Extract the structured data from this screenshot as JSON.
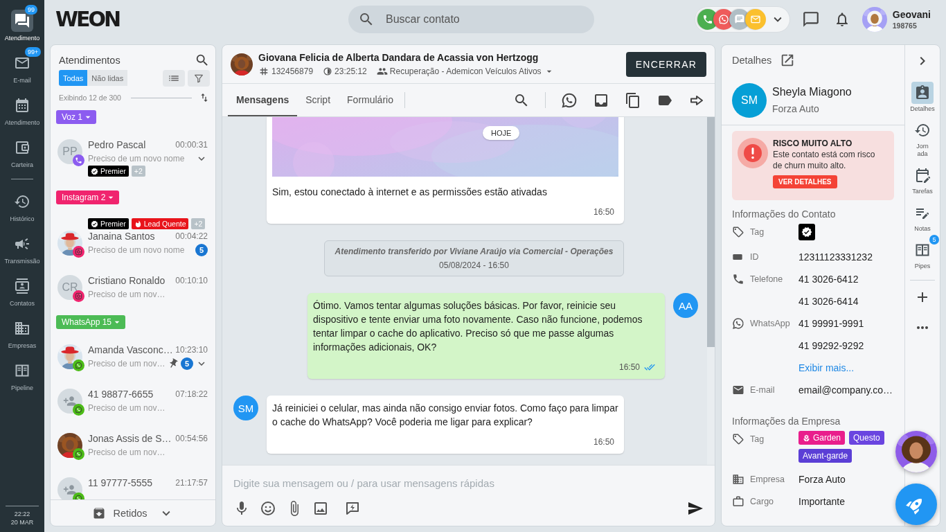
{
  "rail": {
    "sections": [
      {
        "items": [
          {
            "kind": "chat",
            "label": "Atendimento",
            "badge": "99",
            "selected": true
          },
          {
            "kind": "mail",
            "label": "E-mail",
            "badge": "99+",
            "selected": false
          },
          {
            "kind": "calendar",
            "label": "Atendimento",
            "selected": false
          },
          {
            "kind": "wallet",
            "label": "Carteira",
            "selected": false
          }
        ]
      },
      {
        "items": [
          {
            "kind": "history",
            "label": "Histórico",
            "selected": false
          },
          {
            "kind": "megaphone",
            "label": "Transmissão",
            "selected": false
          },
          {
            "kind": "contacts",
            "label": "Contatos",
            "selected": false
          },
          {
            "kind": "building",
            "label": "Empresas",
            "selected": false
          },
          {
            "kind": "pipeline",
            "label": "Pipeline",
            "selected": false
          }
        ]
      }
    ],
    "clock": {
      "time": "22:22",
      "date": "20 MAR"
    }
  },
  "topbar": {
    "logo": "WEON",
    "search": {
      "placeholder": "Buscar contato"
    },
    "channels": [
      {
        "kind": "phone",
        "color": "#4caf50"
      },
      {
        "kind": "whatsapp",
        "color": "#ef5b5b"
      },
      {
        "kind": "sms",
        "color": "#b0bec5"
      },
      {
        "kind": "mail",
        "color": "#fbc02d"
      }
    ],
    "user": {
      "name": "Geovani",
      "id": "198765"
    }
  },
  "conversations": {
    "title": "Atendimentos",
    "filters": [
      {
        "label": "Todas",
        "selected": true
      },
      {
        "label": "Não lidas",
        "selected": false
      }
    ],
    "count": "Exibindo 12 de 300",
    "groups": [
      {
        "label": "Voz 1",
        "color": "#8c5cf0",
        "items": [
          {
            "name": "Pedro Pascal",
            "time": "00:00:31",
            "preview": "Preciso de um novo nome",
            "avatar": {
              "kind": "initials",
              "text": "PP"
            },
            "channel": {
              "kind": "phone"
            },
            "kind": "tagsbelow",
            "tags": [
              {
                "kind": "premier",
                "label": "Premier",
                "color": "#000000"
              },
              {
                "kind": "more",
                "label": "+2",
                "color": "#b8c2c8"
              }
            ],
            "pinned": false,
            "menu": true
          }
        ]
      },
      {
        "label": "Instagram 2",
        "color": "#f0246e",
        "items": [
          {
            "name": "Janaina Santos",
            "time": "00:04:22",
            "preview": "Preciso de um novo nome",
            "avatar": {
              "kind": "picture"
            },
            "channel": {
              "kind": "instagram"
            },
            "kind": "tagsabove",
            "tags": [
              {
                "kind": "premier",
                "label": "Premier",
                "color": "#000000"
              },
              {
                "kind": "hot",
                "label": "Lead Quente",
                "color": "#e8141b"
              },
              {
                "kind": "more",
                "label": "+2",
                "color": "#b8c2c8"
              }
            ],
            "unread": "5",
            "pinned": false,
            "menu": false
          },
          {
            "name": "Cristiano Ronaldo",
            "time": "00:10:10",
            "preview": "Preciso de um nov…",
            "avatar": {
              "kind": "initials",
              "text": "CR"
            },
            "channel": {
              "kind": "instagram"
            },
            "pinned": false,
            "menu": false
          }
        ]
      },
      {
        "label": "WhatsApp 15",
        "color": "#4cbb55",
        "items": [
          {
            "name": "Amanda Vasconc…",
            "time": "10:23:10",
            "preview": "Preciso de um nov…",
            "avatar": {
              "kind": "picture"
            },
            "channel": {
              "kind": "whatsapp"
            },
            "unread": "5",
            "pinned": true,
            "menu": true
          },
          {
            "name": "41 98877-6655",
            "time": "07:18:22",
            "preview": "Preciso de um nov…",
            "avatar": {
              "kind": "unknown"
            },
            "channel": {
              "kind": "whatsapp"
            },
            "pinned": false,
            "menu": false
          },
          {
            "name": "Jonas Assis de S…",
            "time": "00:54:56",
            "preview": "Preciso de um nov…",
            "avatar": {
              "kind": "picture"
            },
            "channel": {
              "kind": "whatsapp"
            },
            "pinned": false,
            "menu": false
          },
          {
            "name": "11 97777-5555",
            "time": "21:17:57",
            "avatar": {
              "kind": "unknown"
            },
            "channel": {
              "kind": "whatsapp"
            },
            "pinned": false,
            "menu": false
          }
        ]
      }
    ],
    "footer": "Retidos"
  },
  "chat": {
    "contact": {
      "name": "Giovana Felicia de Alberta Dandara de Acassia von Hertzogg",
      "protocol": "132456879",
      "timer": "23:25:12",
      "queue": "Recuperação - Ademicon Veículos Ativos"
    },
    "close_button": "ENCERRAR",
    "tabs": [
      {
        "label": "Mensagens",
        "selected": true
      },
      {
        "label": "Script",
        "selected": false
      },
      {
        "label": "Formulário",
        "selected": false
      }
    ],
    "date_chip": "HOJE",
    "messages": [
      {
        "kind": "incoming",
        "image": {
          "kind": "picture"
        },
        "text": "Sim, estou conectado à internet e as permissões estão ativadas",
        "time": "16:50"
      },
      {
        "kind": "system",
        "text": "Atendimento transferido por Viviane Araújo via Comercial - Operações",
        "date": "05/08/2024 - 16:50"
      },
      {
        "kind": "outgoing",
        "avatar": "AA",
        "text": "Ótimo. Vamos tentar algumas soluções básicas. Por favor, reinicie seu dispositivo e tente enviar uma foto novamente. Caso não funcione, podemos tentar limpar o cache do aplicativo. Preciso só que me passe algumas informações adicionais, OK?",
        "time": "16:50",
        "read": true
      },
      {
        "kind": "incoming",
        "avatar": "SM",
        "text": "Já reiniciei o celular, mas ainda não consigo enviar fotos. Como faço para limpar o cache do WhatsApp? Você poderia me ligar para explicar?",
        "time": "16:50"
      }
    ],
    "composer": {
      "placeholder": "Digite sua mensagem ou / para usar mensagens rápidas"
    }
  },
  "details": {
    "title": "Detalhes",
    "contact": {
      "initials": "SM",
      "name": "Sheyla Miagono",
      "company": "Forza Auto"
    },
    "alert": {
      "title": "RISCO MUITO ALTO",
      "text": "Este contato está com risco de churn muito alto.",
      "button": "VER DETALHES"
    },
    "contact_info": {
      "title": "Informações do Contato",
      "rows": [
        {
          "kind": "tag",
          "label": "Tag",
          "tags": [
            {
              "kind": "premier",
              "color": "#000000"
            }
          ]
        },
        {
          "kind": "id",
          "label": "ID",
          "values": [
            "12311123331232"
          ]
        },
        {
          "kind": "phone",
          "label": "Telefone",
          "values": [
            "41 3026-6412",
            "41 3026-6414"
          ]
        },
        {
          "kind": "whatsapp",
          "label": "WhatsApp",
          "values": [
            "41 99991-9991",
            "41 99292-9292"
          ],
          "link": "Exibir mais..."
        },
        {
          "kind": "email",
          "label": "E-mail",
          "values": [
            "email@company.co…"
          ]
        }
      ]
    },
    "company_info": {
      "title": "Informações da Empresa",
      "rows": [
        {
          "kind": "tag",
          "label": "Tag",
          "tags": [
            {
              "kind": "flower",
              "label": "Garden",
              "color": "#e91e8c"
            },
            {
              "label": "Questo",
              "color": "#6a45e0"
            },
            {
              "label": "Avant-garde",
              "color": "#5b3fd6"
            }
          ]
        },
        {
          "kind": "building",
          "label": "Empresa",
          "values": [
            "Forza Auto"
          ]
        },
        {
          "kind": "briefcase",
          "label": "Cargo",
          "values": [
            "Importante"
          ]
        }
      ]
    }
  },
  "details_rail": {
    "items": [
      {
        "kind": "person",
        "label": "Detalhes",
        "wrap": false,
        "selected": true
      },
      {
        "kind": "history",
        "label": "Jornada",
        "wrap": true,
        "selected": false
      },
      {
        "kind": "edit-calendar",
        "label": "Tarefas",
        "wrap": false,
        "selected": false
      },
      {
        "kind": "notes",
        "label": "Notas",
        "wrap": false,
        "selected": false
      },
      {
        "kind": "pipeline",
        "label": "Pipes",
        "badge": "5",
        "wrap": false,
        "selected": false
      }
    ]
  }
}
